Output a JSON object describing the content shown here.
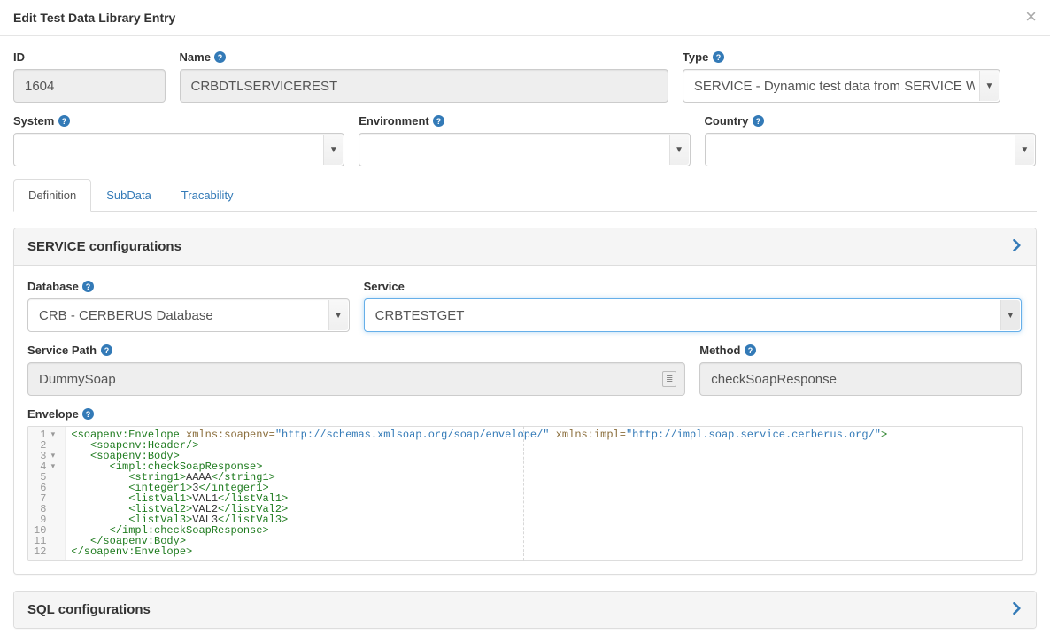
{
  "header": {
    "title": "Edit Test Data Library Entry",
    "close_label": "×"
  },
  "fields": {
    "id": {
      "label": "ID",
      "value": "1604"
    },
    "name": {
      "label": "Name",
      "value": "CRBDTLSERVICEREST"
    },
    "type": {
      "label": "Type",
      "value": "SERVICE - Dynamic test data from SERVICE Webs"
    },
    "system": {
      "label": "System",
      "value": ""
    },
    "environment": {
      "label": "Environment",
      "value": ""
    },
    "country": {
      "label": "Country",
      "value": ""
    }
  },
  "tabs": [
    {
      "key": "definition",
      "label": "Definition",
      "active": true
    },
    {
      "key": "subdata",
      "label": "SubData",
      "active": false
    },
    {
      "key": "tracability",
      "label": "Tracability",
      "active": false
    }
  ],
  "panels": {
    "service": {
      "title": "SERVICE configurations",
      "fields": {
        "database": {
          "label": "Database",
          "value": "CRB - CERBERUS Database"
        },
        "service": {
          "label": "Service",
          "value": "CRBTESTGET"
        },
        "service_path": {
          "label": "Service Path",
          "value": "DummySoap"
        },
        "method": {
          "label": "Method",
          "value": "checkSoapResponse"
        },
        "envelope": {
          "label": "Envelope"
        }
      }
    },
    "sql": {
      "title": "SQL configurations"
    }
  },
  "envelope_xml": {
    "ns_soap": "http://schemas.xmlsoap.org/soap/envelope/",
    "ns_impl": "http://impl.soap.service.cerberus.org/",
    "string1": "AAAA",
    "integer1": "3",
    "listVal1": "VAL1",
    "listVal2": "VAL2",
    "listVal3": "VAL3",
    "line_numbers": [
      "1",
      "2",
      "3",
      "4",
      "5",
      "6",
      "7",
      "8",
      "9",
      "10",
      "11",
      "12"
    ]
  }
}
